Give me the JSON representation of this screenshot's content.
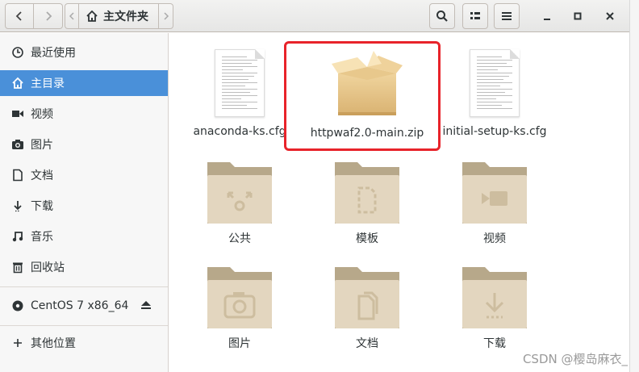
{
  "header": {
    "breadcrumb_label": "主文件夹"
  },
  "sidebar": {
    "items": [
      {
        "label": "最近使用",
        "icon": "clock-icon"
      },
      {
        "label": "主目录",
        "icon": "home-icon",
        "active": true
      },
      {
        "label": "视频",
        "icon": "video-icon"
      },
      {
        "label": "图片",
        "icon": "camera-icon"
      },
      {
        "label": "文档",
        "icon": "document-icon"
      },
      {
        "label": "下载",
        "icon": "download-icon"
      },
      {
        "label": "音乐",
        "icon": "music-icon"
      },
      {
        "label": "回收站",
        "icon": "trash-icon"
      }
    ],
    "device": {
      "label": "CentOS 7 x86_64",
      "icon": "disc-icon"
    },
    "other": {
      "label": "其他位置",
      "icon": "plus-icon"
    }
  },
  "files": [
    {
      "name": "anaconda-ks.cfg",
      "type": "text-file"
    },
    {
      "name": "httpwaf2.0-main.zip",
      "type": "archive",
      "highlighted": true
    },
    {
      "name": "initial-setup-ks.cfg",
      "type": "text-file"
    },
    {
      "name": "公共",
      "type": "folder-share"
    },
    {
      "name": "模板",
      "type": "folder-template"
    },
    {
      "name": "视频",
      "type": "folder-video"
    },
    {
      "name": "图片",
      "type": "folder-pictures"
    },
    {
      "name": "文档",
      "type": "folder-documents"
    },
    {
      "name": "下载",
      "type": "folder-download"
    }
  ],
  "watermark": "CSDN @樱岛麻衣_",
  "colors": {
    "accent": "#4a90d9",
    "highlight_box": "#e8232a",
    "folder": "#d8c9ae"
  }
}
